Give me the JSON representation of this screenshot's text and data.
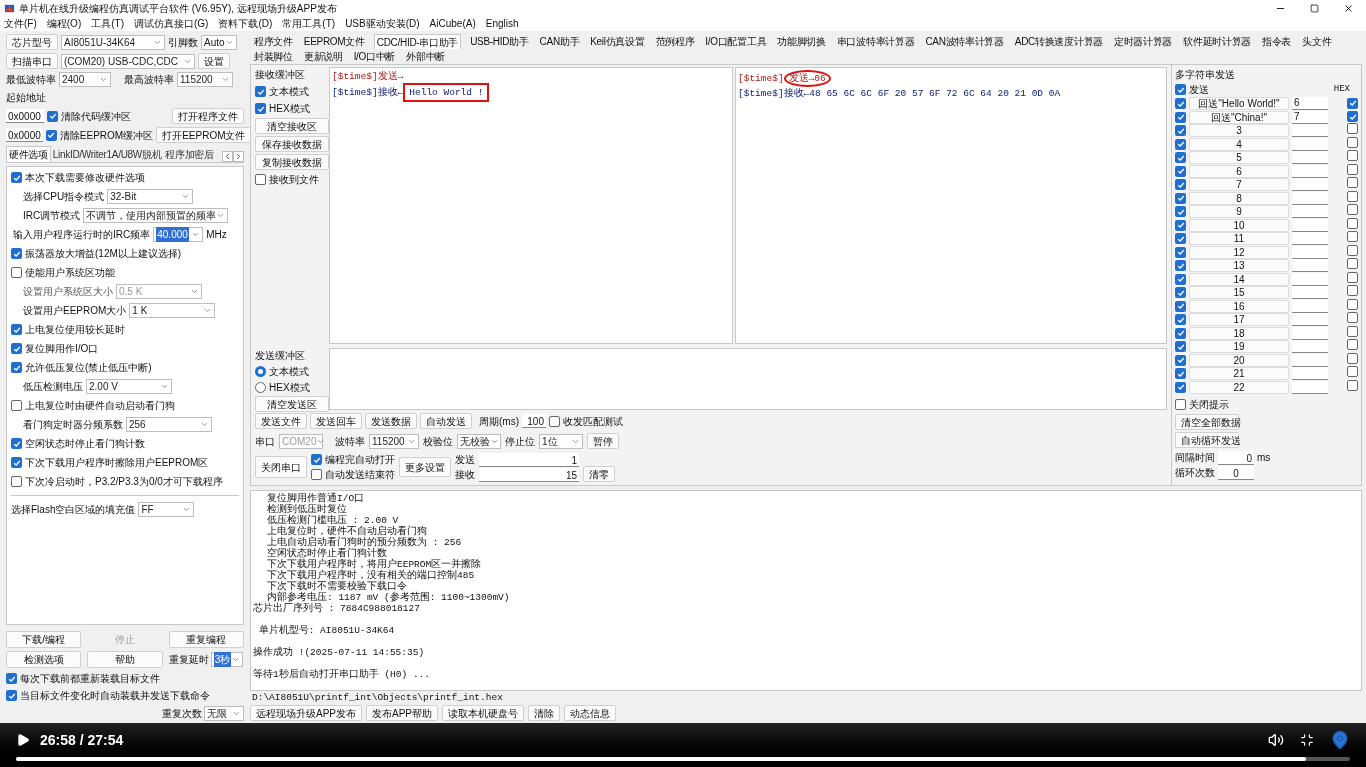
{
  "window": {
    "title": "单片机在线升级编程仿真调试平台软件 (V6.95Y), 远程现场升级APP发布"
  },
  "menu": [
    "文件(F)",
    "编程(O)",
    "工具(T)",
    "调试仿真接口(G)",
    "资料下载(D)",
    "常用工具(T)",
    "USB驱动安装(D)",
    "AiCube(A)",
    "English"
  ],
  "chip": {
    "label": "芯片型号",
    "value": "AI8051U-34K64",
    "pins_label": "引脚数",
    "pins_value": "Auto"
  },
  "port": {
    "button": "扫描串口",
    "value": "(COM20) USB-CDC,CDC",
    "settings": "设置"
  },
  "baud": {
    "min_label": "最低波特率",
    "min_value": "2400",
    "max_label": "最高波特率",
    "max_value": "115200"
  },
  "start_address": {
    "label": "起始地址",
    "rows": [
      {
        "address": "0x0000",
        "option": "清除代码缓冲区",
        "checked": true,
        "button": "打开程序文件"
      },
      {
        "address": "0x0000",
        "option": "清除EEPROM缓冲区",
        "checked": true,
        "button": "打开EEPROM文件"
      }
    ]
  },
  "option_tabs": [
    {
      "label": "硬件选项",
      "selected": true
    },
    {
      "label": "LinkID/Writer1A/U8W脱机",
      "selected": false
    },
    {
      "label": "程序加密后",
      "selected": false
    }
  ],
  "hardware_options": [
    {
      "kind": "check",
      "label": "本次下载需要修改硬件选项",
      "checked": true
    },
    {
      "kind": "option",
      "label": "选择CPU指令模式",
      "value": "32-Bit",
      "disabled": false,
      "value_selected": false
    },
    {
      "kind": "option",
      "label": "IRC调节模式",
      "value": "不调节，使用内部预置的频率",
      "disabled": false,
      "value_selected": false
    },
    {
      "kind": "input",
      "label": "输入用户程序运行时的IRC频率",
      "value": "40.000",
      "unit": "MHz",
      "disabled": false,
      "value_selected": true
    },
    {
      "kind": "check",
      "label": "振荡器放大增益(12M以上建议选择)",
      "checked": true
    },
    {
      "kind": "check",
      "label": "使能用户系统区功能",
      "checked": false
    },
    {
      "kind": "option",
      "label": "设置用户系统区大小",
      "value": "0.5 K",
      "disabled": true,
      "value_selected": false
    },
    {
      "kind": "option",
      "label": "设置用户EEPROM大小",
      "value": "1  K",
      "disabled": false,
      "value_selected": false
    },
    {
      "kind": "check",
      "label": "上电复位使用较长延时",
      "checked": true
    },
    {
      "kind": "check",
      "label": "复位脚用作I/O口",
      "checked": true
    },
    {
      "kind": "check",
      "label": "允许低压复位(禁止低压中断)",
      "checked": true
    },
    {
      "kind": "option",
      "label": "低压检测电压",
      "value": "2.00 V",
      "disabled": false,
      "value_selected": false
    },
    {
      "kind": "check",
      "label": "上电复位时由硬件自动启动看门狗",
      "checked": false
    },
    {
      "kind": "option",
      "label": "看门狗定时器分频系数",
      "value": "256",
      "disabled": false,
      "value_selected": false
    },
    {
      "kind": "check",
      "label": "空闲状态时停止看门狗计数",
      "checked": true
    },
    {
      "kind": "check",
      "label": "下次下载用户程序时擦除用户EEPROM区",
      "checked": true
    },
    {
      "kind": "check",
      "label": "下次冷启动时，P3.2/P3.3为0/0才可下载程序",
      "checked": false
    },
    {
      "kind": "fill",
      "label": "选择Flash空白区域的填充值",
      "value": "FF",
      "disabled": false,
      "value_selected": false
    }
  ],
  "program_buttons": [
    {
      "label": "下载/编程",
      "disabled": false
    },
    {
      "label": "停止",
      "disabled": true
    },
    {
      "label": "重复编程",
      "disabled": false
    },
    {
      "label": "检测选项",
      "disabled": false
    },
    {
      "label": "帮助",
      "disabled": false
    }
  ],
  "repeat": [
    {
      "label": "重复延时",
      "value": "3秒",
      "value_selected": true
    },
    {
      "label": "重复次数",
      "value": "无限",
      "value_selected": false
    }
  ],
  "load_options": [
    {
      "label": "每次下载前都重新装载目标文件",
      "checked": true
    },
    {
      "label": "当目标文件变化时自动装载并发送下载命令",
      "checked": true
    }
  ],
  "tool_tabs": [
    {
      "label": "程序文件",
      "selected": false
    },
    {
      "label": "EEPROM文件",
      "selected": false
    },
    {
      "label": "CDC/HID-串口助手",
      "selected": true
    },
    {
      "label": "USB-HID助手",
      "selected": false
    },
    {
      "label": "CAN助手",
      "selected": false
    },
    {
      "label": "Keil仿真设置",
      "selected": false
    },
    {
      "label": "范例程序",
      "selected": false
    },
    {
      "label": "I/O口配置工具",
      "selected": false
    },
    {
      "label": "功能脚切换",
      "selected": false
    },
    {
      "label": "串口波特率计算器",
      "selected": false
    },
    {
      "label": "CAN波特率计算器",
      "selected": false
    },
    {
      "label": "ADC转换速度计算器",
      "selected": false
    },
    {
      "label": "定时器计算器",
      "selected": false
    },
    {
      "label": "软件延时计算器",
      "selected": false
    },
    {
      "label": "指令表",
      "selected": false
    },
    {
      "label": "头文件",
      "selected": false
    },
    {
      "label": "封装脚位",
      "selected": false
    },
    {
      "label": "更新说明",
      "selected": false
    },
    {
      "label": "I/O口中断",
      "selected": false
    },
    {
      "label": "外部中断",
      "selected": false
    }
  ],
  "receive": {
    "title": "接收缓冲区",
    "modes": [
      {
        "label": "文本模式",
        "checked": true
      },
      {
        "label": "HEX模式",
        "checked": true
      }
    ],
    "buttons": [
      "清空接收区",
      "保存接收数据",
      "复制接收数据"
    ],
    "to_file": {
      "label": "接收到文件",
      "checked": false
    },
    "text_view": [
      {
        "kind": "send",
        "text": "[$time$]发送→"
      },
      {
        "kind": "receive",
        "text": "[$time$]接收←",
        "marked": "Hello World !",
        "boxed": true,
        "circled": false
      }
    ],
    "hex_view": [
      {
        "kind": "send",
        "text": "[$time$]",
        "marked": "发送→06",
        "boxed": false,
        "circled": true
      },
      {
        "kind": "receive",
        "text": "[$time$]接收←48 65 6C 6C 6F 20 57 6F 72 6C 64 20 21 0D 0A"
      }
    ]
  },
  "send": {
    "title": "发送缓冲区",
    "modes": [
      {
        "label": "文本模式",
        "selected": true
      },
      {
        "label": "HEX模式",
        "selected": false
      }
    ],
    "clear": "清空发送区",
    "actions": [
      "发送文件",
      "发送回车",
      "发送数据",
      "自动发送"
    ],
    "period_label": "周期(ms)",
    "period": "100",
    "match_test": {
      "label": "收发匹配测试",
      "checked": false
    }
  },
  "serial": {
    "port_label": "串口",
    "port": "COM20",
    "baud_label": "波特率",
    "baud": "115200",
    "parity_label": "校验位",
    "parity": "无校验",
    "stop_label": "停止位",
    "stop": "1位",
    "pause": "暂停",
    "close": "关闭串口",
    "auto_open": {
      "label": "编程完自动打开",
      "checked": true
    },
    "auto_end": {
      "label": "自动发送结束符",
      "checked": false
    },
    "more": "更多设置",
    "sent_label": "发送",
    "sent": "1",
    "received_label": "接收",
    "received": "15",
    "clear": "清零"
  },
  "multi_send": {
    "title": "多字符串发送",
    "send_all": {
      "label": "发送",
      "checked": true
    },
    "hex_label": "HEX",
    "rows": [
      {
        "checked": true,
        "label": "回送\"Hello World!\"",
        "value": "6",
        "hex": true
      },
      {
        "checked": true,
        "label": "回送\"China!\"",
        "value": "7",
        "hex": true
      },
      {
        "checked": true,
        "label": "3",
        "hex": false
      },
      {
        "checked": true,
        "label": "4",
        "hex": false
      },
      {
        "checked": true,
        "label": "5",
        "hex": false
      },
      {
        "checked": true,
        "label": "6",
        "hex": false
      },
      {
        "checked": true,
        "label": "7",
        "hex": false
      },
      {
        "checked": true,
        "label": "8",
        "hex": false
      },
      {
        "checked": true,
        "label": "9",
        "hex": false
      },
      {
        "checked": true,
        "label": "10",
        "hex": false
      },
      {
        "checked": true,
        "label": "11",
        "hex": false
      },
      {
        "checked": true,
        "label": "12",
        "hex": false
      },
      {
        "checked": true,
        "label": "13",
        "hex": false
      },
      {
        "checked": true,
        "label": "14",
        "hex": false
      },
      {
        "checked": true,
        "label": "15",
        "hex": false
      },
      {
        "checked": true,
        "label": "16",
        "hex": false
      },
      {
        "checked": true,
        "label": "17",
        "hex": false
      },
      {
        "checked": true,
        "label": "18",
        "hex": false
      },
      {
        "checked": true,
        "label": "19",
        "hex": false
      },
      {
        "checked": true,
        "label": "20",
        "hex": false
      },
      {
        "checked": true,
        "label": "21",
        "hex": false
      },
      {
        "checked": true,
        "label": "22",
        "hex": false
      }
    ],
    "close_hint": {
      "label": "关闭提示",
      "checked": false
    },
    "buttons": [
      "清空全部数据",
      "自动循环发送"
    ],
    "interval_label": "间隔时间",
    "interval": "0",
    "interval_unit": "ms",
    "loop_label": "循环次数",
    "loop": "0"
  },
  "log": [
    {
      "kind": "detail",
      "text": "复位脚用作普通I/O口",
      "spaced": false
    },
    {
      "kind": "detail",
      "text": "检测到低压时复位",
      "spaced": false
    },
    {
      "kind": "detail",
      "text": "低压检测门槛电压 : 2.00 V",
      "spaced": false
    },
    {
      "kind": "detail",
      "text": "上电复位时，硬件不自动启动看门狗",
      "spaced": false
    },
    {
      "kind": "detail",
      "text": "上电自动启动看门狗时的预分频数为 : 256",
      "spaced": false
    },
    {
      "kind": "detail",
      "text": "空闲状态时停止看门狗计数",
      "spaced": false
    },
    {
      "kind": "detail",
      "text": "下次下载用户程序时，将用户EEPROM区一并擦除",
      "spaced": false
    },
    {
      "kind": "detail",
      "text": "下次下载用户程序时，没有相关的端口控制485",
      "spaced": false
    },
    {
      "kind": "detail",
      "text": "下次下载时不需要校验下载口令",
      "spaced": false
    },
    {
      "kind": "detail",
      "text": "内部参考电压: 1187 mV (参考范围: 1100~1300mV)",
      "spaced": false
    },
    {
      "kind": "info",
      "text": "芯片出厂序列号 : 7884C988018127",
      "spaced": false
    },
    {
      "kind": "info",
      "text": " 单片机型号: AI8051U-34K64",
      "spaced": true
    },
    {
      "kind": "info",
      "text": "操作成功 !(2025-07-11 14:55:35)",
      "spaced": true
    },
    {
      "kind": "info",
      "text": "等待1秒后自动打开串口助手 (H0) ...",
      "spaced": true
    }
  ],
  "file_path": "D:\\AI8051U\\printf_int\\Objects\\printf_int.hex",
  "status_buttons": [
    "远程现场升级APP发布",
    "发布APP帮助",
    "读取本机硬盘号",
    "清除",
    "动态信息"
  ],
  "player": {
    "time": "26:58 / 27:54",
    "level": 0.967
  }
}
